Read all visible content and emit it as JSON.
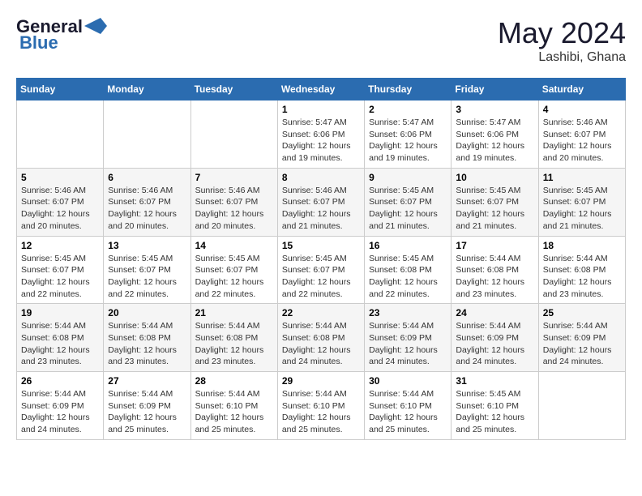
{
  "header": {
    "logo_line1": "General",
    "logo_line2": "Blue",
    "month_year": "May 2024",
    "location": "Lashibi, Ghana"
  },
  "days_of_week": [
    "Sunday",
    "Monday",
    "Tuesday",
    "Wednesday",
    "Thursday",
    "Friday",
    "Saturday"
  ],
  "weeks": [
    [
      {
        "day": "",
        "sunrise": "",
        "sunset": "",
        "daylight": "",
        "empty": true
      },
      {
        "day": "",
        "sunrise": "",
        "sunset": "",
        "daylight": "",
        "empty": true
      },
      {
        "day": "",
        "sunrise": "",
        "sunset": "",
        "daylight": "",
        "empty": true
      },
      {
        "day": "1",
        "sunrise": "Sunrise: 5:47 AM",
        "sunset": "Sunset: 6:06 PM",
        "daylight": "Daylight: 12 hours and 19 minutes."
      },
      {
        "day": "2",
        "sunrise": "Sunrise: 5:47 AM",
        "sunset": "Sunset: 6:06 PM",
        "daylight": "Daylight: 12 hours and 19 minutes."
      },
      {
        "day": "3",
        "sunrise": "Sunrise: 5:47 AM",
        "sunset": "Sunset: 6:06 PM",
        "daylight": "Daylight: 12 hours and 19 minutes."
      },
      {
        "day": "4",
        "sunrise": "Sunrise: 5:46 AM",
        "sunset": "Sunset: 6:07 PM",
        "daylight": "Daylight: 12 hours and 20 minutes."
      }
    ],
    [
      {
        "day": "5",
        "sunrise": "Sunrise: 5:46 AM",
        "sunset": "Sunset: 6:07 PM",
        "daylight": "Daylight: 12 hours and 20 minutes."
      },
      {
        "day": "6",
        "sunrise": "Sunrise: 5:46 AM",
        "sunset": "Sunset: 6:07 PM",
        "daylight": "Daylight: 12 hours and 20 minutes."
      },
      {
        "day": "7",
        "sunrise": "Sunrise: 5:46 AM",
        "sunset": "Sunset: 6:07 PM",
        "daylight": "Daylight: 12 hours and 20 minutes."
      },
      {
        "day": "8",
        "sunrise": "Sunrise: 5:46 AM",
        "sunset": "Sunset: 6:07 PM",
        "daylight": "Daylight: 12 hours and 21 minutes."
      },
      {
        "day": "9",
        "sunrise": "Sunrise: 5:45 AM",
        "sunset": "Sunset: 6:07 PM",
        "daylight": "Daylight: 12 hours and 21 minutes."
      },
      {
        "day": "10",
        "sunrise": "Sunrise: 5:45 AM",
        "sunset": "Sunset: 6:07 PM",
        "daylight": "Daylight: 12 hours and 21 minutes."
      },
      {
        "day": "11",
        "sunrise": "Sunrise: 5:45 AM",
        "sunset": "Sunset: 6:07 PM",
        "daylight": "Daylight: 12 hours and 21 minutes."
      }
    ],
    [
      {
        "day": "12",
        "sunrise": "Sunrise: 5:45 AM",
        "sunset": "Sunset: 6:07 PM",
        "daylight": "Daylight: 12 hours and 22 minutes."
      },
      {
        "day": "13",
        "sunrise": "Sunrise: 5:45 AM",
        "sunset": "Sunset: 6:07 PM",
        "daylight": "Daylight: 12 hours and 22 minutes."
      },
      {
        "day": "14",
        "sunrise": "Sunrise: 5:45 AM",
        "sunset": "Sunset: 6:07 PM",
        "daylight": "Daylight: 12 hours and 22 minutes."
      },
      {
        "day": "15",
        "sunrise": "Sunrise: 5:45 AM",
        "sunset": "Sunset: 6:07 PM",
        "daylight": "Daylight: 12 hours and 22 minutes."
      },
      {
        "day": "16",
        "sunrise": "Sunrise: 5:45 AM",
        "sunset": "Sunset: 6:08 PM",
        "daylight": "Daylight: 12 hours and 22 minutes."
      },
      {
        "day": "17",
        "sunrise": "Sunrise: 5:44 AM",
        "sunset": "Sunset: 6:08 PM",
        "daylight": "Daylight: 12 hours and 23 minutes."
      },
      {
        "day": "18",
        "sunrise": "Sunrise: 5:44 AM",
        "sunset": "Sunset: 6:08 PM",
        "daylight": "Daylight: 12 hours and 23 minutes."
      }
    ],
    [
      {
        "day": "19",
        "sunrise": "Sunrise: 5:44 AM",
        "sunset": "Sunset: 6:08 PM",
        "daylight": "Daylight: 12 hours and 23 minutes."
      },
      {
        "day": "20",
        "sunrise": "Sunrise: 5:44 AM",
        "sunset": "Sunset: 6:08 PM",
        "daylight": "Daylight: 12 hours and 23 minutes."
      },
      {
        "day": "21",
        "sunrise": "Sunrise: 5:44 AM",
        "sunset": "Sunset: 6:08 PM",
        "daylight": "Daylight: 12 hours and 23 minutes."
      },
      {
        "day": "22",
        "sunrise": "Sunrise: 5:44 AM",
        "sunset": "Sunset: 6:08 PM",
        "daylight": "Daylight: 12 hours and 24 minutes."
      },
      {
        "day": "23",
        "sunrise": "Sunrise: 5:44 AM",
        "sunset": "Sunset: 6:09 PM",
        "daylight": "Daylight: 12 hours and 24 minutes."
      },
      {
        "day": "24",
        "sunrise": "Sunrise: 5:44 AM",
        "sunset": "Sunset: 6:09 PM",
        "daylight": "Daylight: 12 hours and 24 minutes."
      },
      {
        "day": "25",
        "sunrise": "Sunrise: 5:44 AM",
        "sunset": "Sunset: 6:09 PM",
        "daylight": "Daylight: 12 hours and 24 minutes."
      }
    ],
    [
      {
        "day": "26",
        "sunrise": "Sunrise: 5:44 AM",
        "sunset": "Sunset: 6:09 PM",
        "daylight": "Daylight: 12 hours and 24 minutes."
      },
      {
        "day": "27",
        "sunrise": "Sunrise: 5:44 AM",
        "sunset": "Sunset: 6:09 PM",
        "daylight": "Daylight: 12 hours and 25 minutes."
      },
      {
        "day": "28",
        "sunrise": "Sunrise: 5:44 AM",
        "sunset": "Sunset: 6:10 PM",
        "daylight": "Daylight: 12 hours and 25 minutes."
      },
      {
        "day": "29",
        "sunrise": "Sunrise: 5:44 AM",
        "sunset": "Sunset: 6:10 PM",
        "daylight": "Daylight: 12 hours and 25 minutes."
      },
      {
        "day": "30",
        "sunrise": "Sunrise: 5:44 AM",
        "sunset": "Sunset: 6:10 PM",
        "daylight": "Daylight: 12 hours and 25 minutes."
      },
      {
        "day": "31",
        "sunrise": "Sunrise: 5:45 AM",
        "sunset": "Sunset: 6:10 PM",
        "daylight": "Daylight: 12 hours and 25 minutes."
      },
      {
        "day": "",
        "sunrise": "",
        "sunset": "",
        "daylight": "",
        "empty": true
      }
    ]
  ]
}
